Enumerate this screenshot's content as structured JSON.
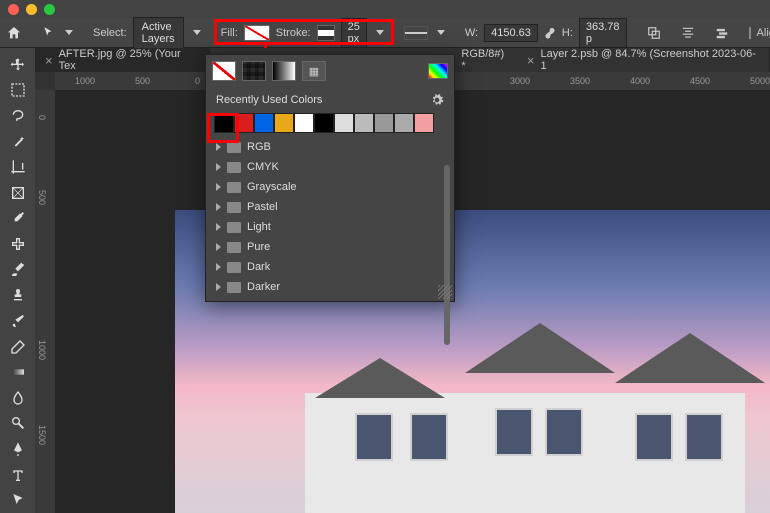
{
  "optionsBar": {
    "selectLabel": "Select:",
    "selectValue": "Active Layers",
    "fillLabel": "Fill:",
    "strokeLabel": "Stroke:",
    "strokeWidth": "25 px",
    "wLabel": "W:",
    "wValue": "4150.63",
    "hLabel": "H:",
    "hValue": "363.78 p",
    "alignLabel": "Align"
  },
  "tabs": {
    "tab1": "AFTER.jpg @ 25% (Your Tex",
    "tab1suffix": "RGB/8#) *",
    "tab2": "Layer 2.psb @ 84.7% (Screenshot 2023-06-1"
  },
  "rulerH": {
    "r1": "1000",
    "r2": "500",
    "r3": "0",
    "r4": "3000",
    "r5": "3500",
    "r6": "4000",
    "r7": "4500",
    "r8": "5000"
  },
  "rulerV": {
    "v1": "0",
    "v2": "500",
    "v3": "1000",
    "v4": "1500"
  },
  "popup": {
    "header": "Recently Used Colors",
    "folders": [
      "RGB",
      "CMYK",
      "Grayscale",
      "Pastel",
      "Light",
      "Pure",
      "Dark",
      "Darker"
    ],
    "swatches": [
      "#000000",
      "#d91e1e",
      "#0066e6",
      "#e8a817",
      "#ffffff",
      "#000000",
      "#dddddd",
      "#bbbbbb",
      "#999999",
      "#aaaaaa",
      "#f4a0a0"
    ]
  }
}
